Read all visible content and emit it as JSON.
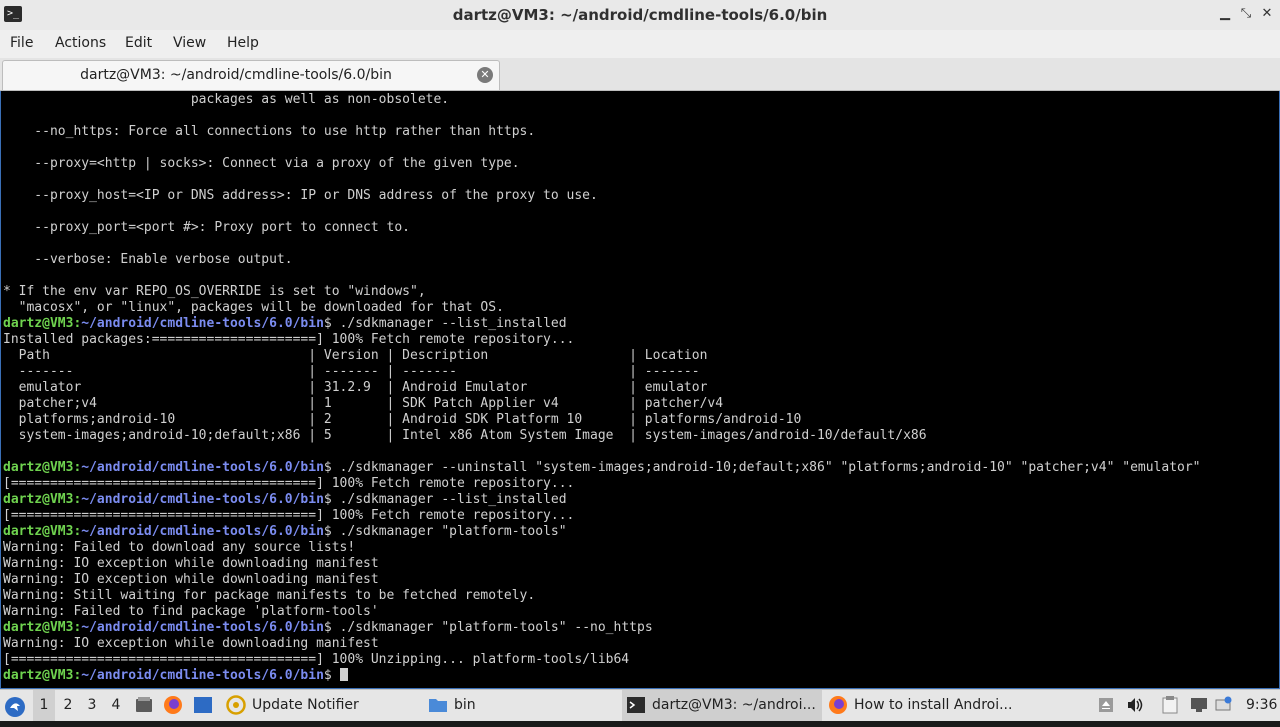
{
  "window": {
    "title": "dartz@VM3: ~/android/cmdline-tools/6.0/bin",
    "minimize": "▁",
    "maximize": "⤡",
    "close": "✕"
  },
  "menu": [
    "File",
    "Actions",
    "Edit",
    "View",
    "Help"
  ],
  "tab": {
    "label": "dartz@VM3: ~/android/cmdline-tools/6.0/bin",
    "close": "✕"
  },
  "prompt": {
    "user": "dartz@VM3",
    "sep": ":",
    "path": "~/android/cmdline-tools/6.0/bin",
    "sym": "$"
  },
  "terminal": {
    "lines": [
      {
        "t": "                        packages as well as non-obsolete."
      },
      {
        "t": ""
      },
      {
        "t": "    --no_https: Force all connections to use http rather than https."
      },
      {
        "t": ""
      },
      {
        "t": "    --proxy=<http | socks>: Connect via a proxy of the given type."
      },
      {
        "t": ""
      },
      {
        "t": "    --proxy_host=<IP or DNS address>: IP or DNS address of the proxy to use."
      },
      {
        "t": ""
      },
      {
        "t": "    --proxy_port=<port #>: Proxy port to connect to."
      },
      {
        "t": ""
      },
      {
        "t": "    --verbose: Enable verbose output."
      },
      {
        "t": ""
      },
      {
        "t": "* If the env var REPO_OS_OVERRIDE is set to \"windows\","
      },
      {
        "t": "  \"macosx\", or \"linux\", packages will be downloaded for that OS."
      },
      {
        "t": " ./sdkmanager --list_installed",
        "prompt": true
      },
      {
        "t": "Installed packages:=====================] 100% Fetch remote repository..."
      },
      {
        "t": "  Path                                 | Version | Description                  | Location"
      },
      {
        "t": "  -------                              | ------- | -------                      | -------"
      },
      {
        "t": "  emulator                             | 31.2.9  | Android Emulator             | emulator"
      },
      {
        "t": "  patcher;v4                           | 1       | SDK Patch Applier v4         | patcher/v4"
      },
      {
        "t": "  platforms;android-10                 | 2       | Android SDK Platform 10      | platforms/android-10"
      },
      {
        "t": "  system-images;android-10;default;x86 | 5       | Intel x86 Atom System Image  | system-images/android-10/default/x86"
      },
      {
        "t": ""
      },
      {
        "t": " ./sdkmanager --uninstall \"system-images;android-10;default;x86\" \"platforms;android-10\" \"patcher;v4\" \"emulator\"",
        "prompt": true
      },
      {
        "t": "[=======================================] 100% Fetch remote repository..."
      },
      {
        "t": " ./sdkmanager --list_installed",
        "prompt": true
      },
      {
        "t": "[=======================================] 100% Fetch remote repository..."
      },
      {
        "t": " ./sdkmanager \"platform-tools\"",
        "prompt": true
      },
      {
        "t": "Warning: Failed to download any source lists!"
      },
      {
        "t": "Warning: IO exception while downloading manifest"
      },
      {
        "t": "Warning: IO exception while downloading manifest"
      },
      {
        "t": "Warning: Still waiting for package manifests to be fetched remotely."
      },
      {
        "t": "Warning: Failed to find package 'platform-tools'"
      },
      {
        "t": " ./sdkmanager \"platform-tools\" --no_https",
        "prompt": true
      },
      {
        "t": "Warning: IO exception while downloading manifest"
      },
      {
        "t": "[=======================================] 100% Unzipping... platform-tools/lib64"
      },
      {
        "t": " ",
        "prompt": true,
        "cursor": true
      }
    ]
  },
  "taskbar": {
    "workspaces": [
      "1",
      "2",
      "3",
      "4"
    ],
    "tasks": {
      "update_notifier": "Update Notifier",
      "bin": "bin",
      "terminal": "dartz@VM3: ~/androi...",
      "browser": "How to install Androi..."
    },
    "clock": "9:36"
  }
}
